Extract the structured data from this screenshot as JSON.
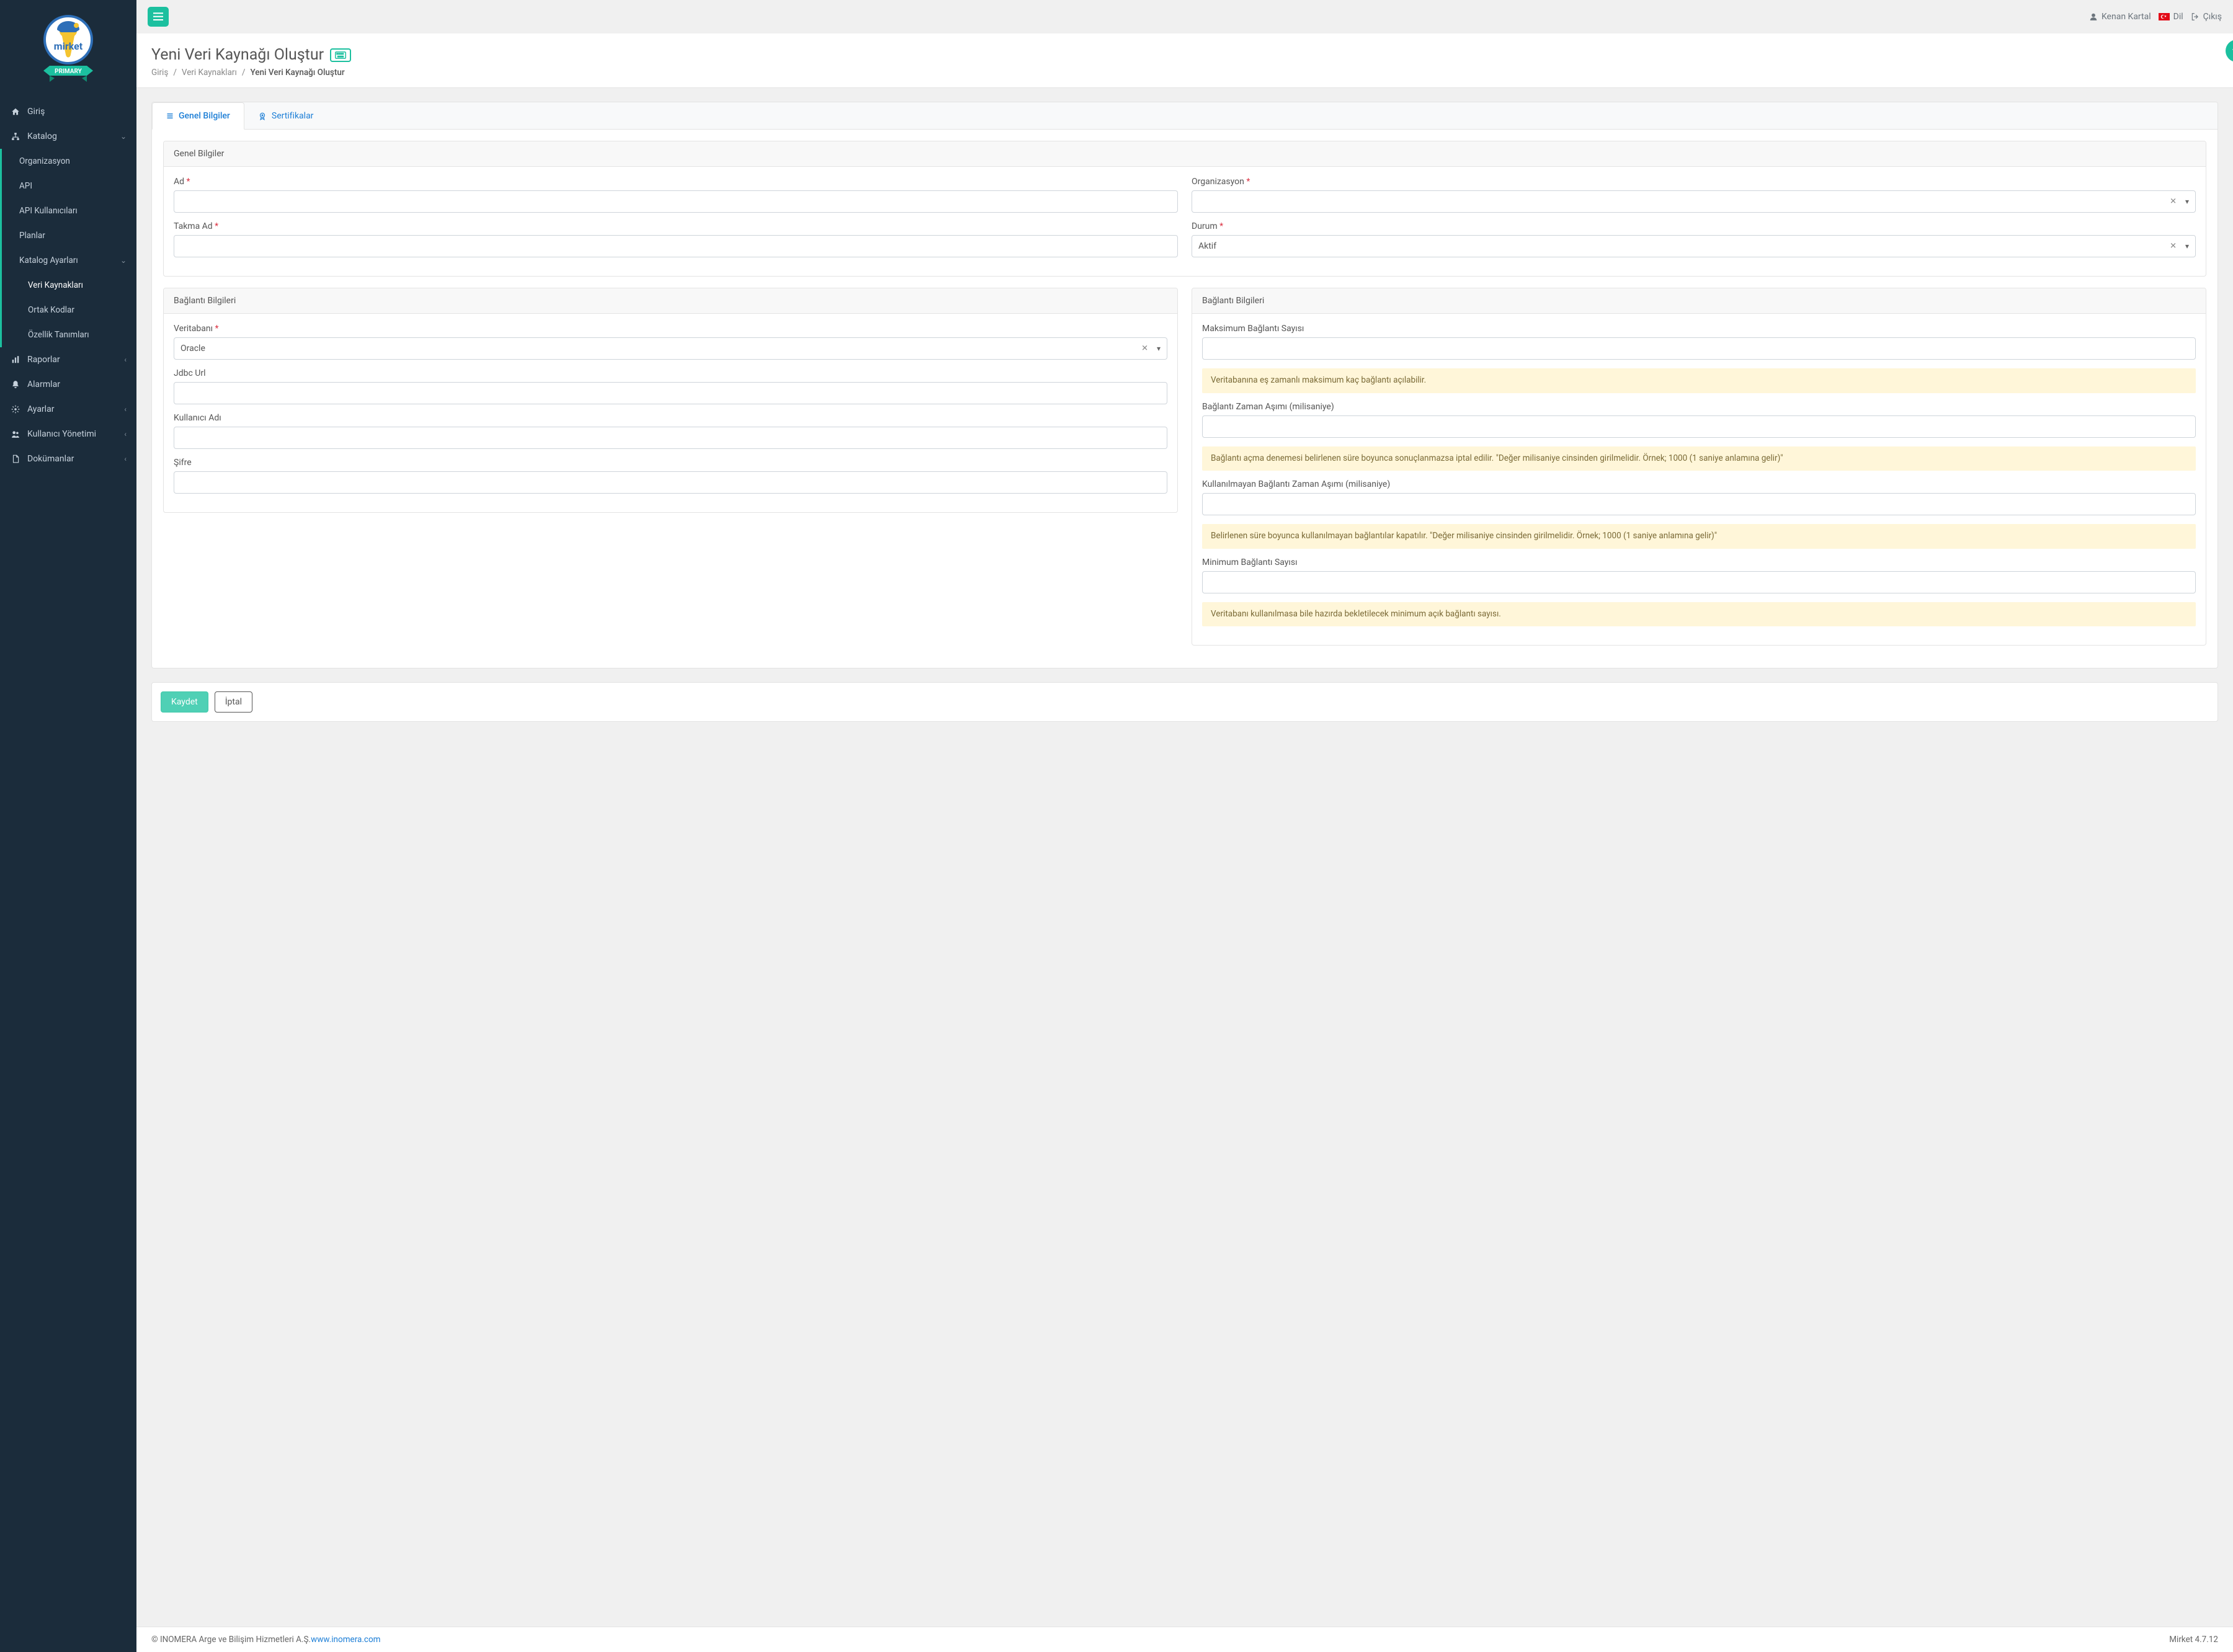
{
  "topbar": {
    "user": "Kenan Kartal",
    "lang": "Dil",
    "logout": "Çıkış"
  },
  "sidebar": {
    "badge": "PRIMARY",
    "items": [
      {
        "icon": "home",
        "label": "Giriş"
      },
      {
        "icon": "sitemap",
        "label": "Katalog",
        "expandable": true,
        "open": true,
        "children": [
          {
            "label": "Organizasyon"
          },
          {
            "label": "API"
          },
          {
            "label": "API Kullanıcıları"
          },
          {
            "label": "Planlar"
          },
          {
            "label": "Katalog Ayarları",
            "expandable": true,
            "open": true,
            "children": [
              {
                "label": "Veri Kaynakları",
                "active": true
              },
              {
                "label": "Ortak Kodlar"
              },
              {
                "label": "Özellik Tanımları"
              }
            ]
          }
        ]
      },
      {
        "icon": "chart",
        "label": "Raporlar",
        "expandable": true
      },
      {
        "icon": "bell",
        "label": "Alarmlar"
      },
      {
        "icon": "cogs",
        "label": "Ayarlar",
        "expandable": true
      },
      {
        "icon": "users",
        "label": "Kullanıcı Yönetimi",
        "expandable": true
      },
      {
        "icon": "file",
        "label": "Dokümanlar",
        "expandable": true
      }
    ]
  },
  "page": {
    "title": "Yeni Veri Kaynağı Oluştur",
    "breadcrumbs": [
      "Giriş",
      "Veri Kaynakları",
      "Yeni Veri Kaynağı Oluştur"
    ]
  },
  "tabs": [
    {
      "icon": "list",
      "label": "Genel Bilgiler",
      "active": true
    },
    {
      "icon": "cert",
      "label": "Sertifikalar"
    }
  ],
  "form": {
    "section_general": "Genel Bilgiler",
    "labels": {
      "ad": "Ad",
      "organizasyon": "Organizasyon",
      "takma": "Takma Ad",
      "durum": "Durum"
    },
    "required_mark": "*",
    "durum_value": "Aktif",
    "section_conn": "Bağlantı Bilgileri",
    "conn_labels": {
      "db": "Veritabanı",
      "jdbc": "Jdbc Url",
      "user": "Kullanıcı Adı",
      "pass": "Şifre"
    },
    "db_value": "Oracle",
    "section_conn2": "Bağlantı Bilgileri",
    "conn2_labels": {
      "max": "Maksimum Bağlantı Sayısı",
      "timeout": "Bağlantı Zaman Aşımı (milisaniye)",
      "idle": "Kullanılmayan Bağlantı Zaman Aşımı (milisaniye)",
      "min": "Minimum Bağlantı Sayısı"
    },
    "help": {
      "max": "Veritabanına eş zamanlı maksimum kaç bağlantı açılabilir.",
      "timeout": "Bağlantı açma denemesi belirlenen süre boyunca sonuçlanmazsa iptal edilir. \"Değer milisaniye cinsinden girilmelidir. Örnek; 1000 (1 saniye anlamına gelir)\"",
      "idle": "Belirlenen süre boyunca kullanılmayan bağlantılar kapatılır. \"Değer milisaniye cinsinden girilmelidir. Örnek; 1000 (1 saniye anlamına gelir)\"",
      "min": "Veritabanı kullanılmasa bile hazırda bekletilecek minimum açık bağlantı sayısı."
    }
  },
  "actions": {
    "save": "Kaydet",
    "cancel": "İptal"
  },
  "footer": {
    "copyright": "© INOMERA Arge ve Bilişim Hizmetleri A.Ş. ",
    "url": "www.inomera.com",
    "version": "Mirket 4.7.12"
  }
}
